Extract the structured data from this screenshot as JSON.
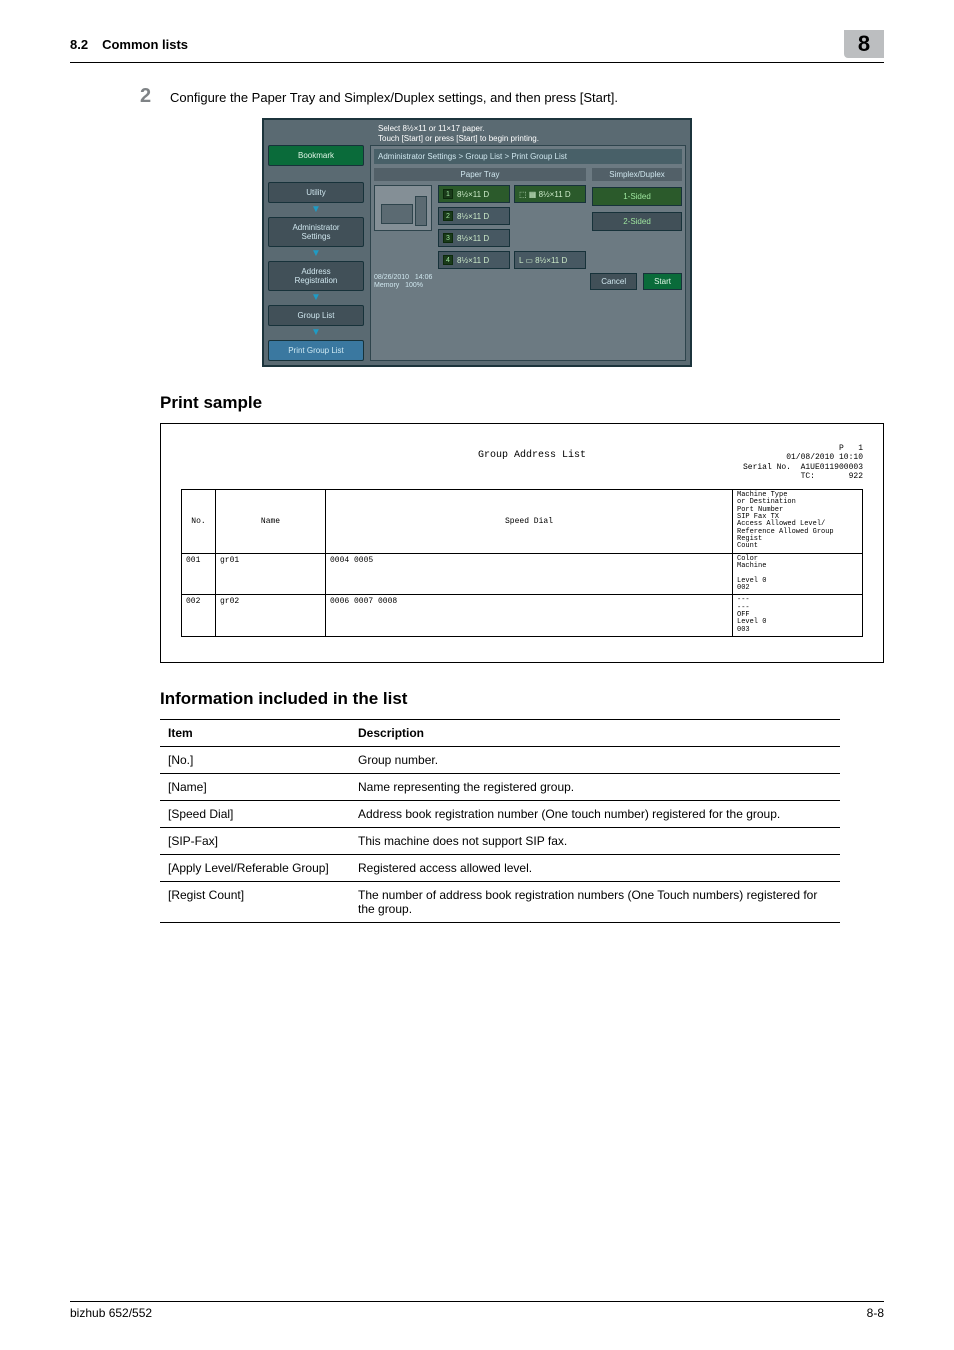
{
  "header": {
    "section_no": "8.2",
    "section_title": "Common lists",
    "chapter_no": "8"
  },
  "step": {
    "num": "2",
    "text": "Configure the Paper Tray and Simplex/Duplex settings, and then press [Start]."
  },
  "panel": {
    "instr1": "Select 8½×11 or 11×17 paper.",
    "instr2": "Touch [Start] or press [Start] to begin printing.",
    "breadcrumb": "Administrator Settings > Group List > Print Group List",
    "side": {
      "bookmark": "Bookmark",
      "utility": "Utility",
      "admin": "Administrator\nSettings",
      "addr": "Address\nRegistration",
      "group": "Group List",
      "print": "Print Group List"
    },
    "col_paper": "Paper Tray",
    "col_duplex": "Simplex/Duplex",
    "trays": {
      "t1": "8½×11 D",
      "t1b": "⬚ ▦ 8½×11 D",
      "t2": "8½×11 D",
      "t3": "8½×11 D",
      "t4": "8½×11 D",
      "t4b": "L ▭ 8½×11 D"
    },
    "duplex": {
      "one": "1-Sided",
      "two": "2-Sided"
    },
    "footer": {
      "date": "08/26/2010",
      "time": "14:06",
      "mem": "Memory",
      "pct": "100%",
      "cancel": "Cancel",
      "start": "Start"
    }
  },
  "heading_sample": "Print sample",
  "sample": {
    "title": "Group Address List",
    "meta_right": "P   1\n01/08/2010 10:10\nSerial No.  A1UE011900003\nTC:       922",
    "th": {
      "no": "No.",
      "name": "Name",
      "speed": "Speed Dial",
      "meta": "Machine Type\nor Destination\nPort Number\nSIP Fax TX\nAccess Allowed Level/\nReference Allowed Group\nRegist\nCount"
    },
    "rows": [
      {
        "no": "001",
        "name": "gr01",
        "speed": "0004 0005",
        "meta": "Color\nMachine\n\nLevel 0\n002"
      },
      {
        "no": "002",
        "name": "gr02",
        "speed": "0006 0007 0008",
        "meta": "---\n---\nOFF\nLevel 0\n003"
      }
    ]
  },
  "heading_info": "Information included in the list",
  "info": {
    "th_item": "Item",
    "th_desc": "Description",
    "rows": [
      {
        "item": "[No.]",
        "desc": "Group number."
      },
      {
        "item": "[Name]",
        "desc": "Name representing the registered group."
      },
      {
        "item": "[Speed Dial]",
        "desc": "Address book registration number (One touch number) registered for the group."
      },
      {
        "item": "[SIP-Fax]",
        "desc": "This machine does not support SIP fax."
      },
      {
        "item": "[Apply Level/Referable Group]",
        "desc": "Registered access allowed level."
      },
      {
        "item": "[Regist Count]",
        "desc": "The number of address book registration numbers (One Touch numbers) registered for the group."
      }
    ]
  },
  "footer": {
    "left": "bizhub 652/552",
    "right": "8-8"
  }
}
